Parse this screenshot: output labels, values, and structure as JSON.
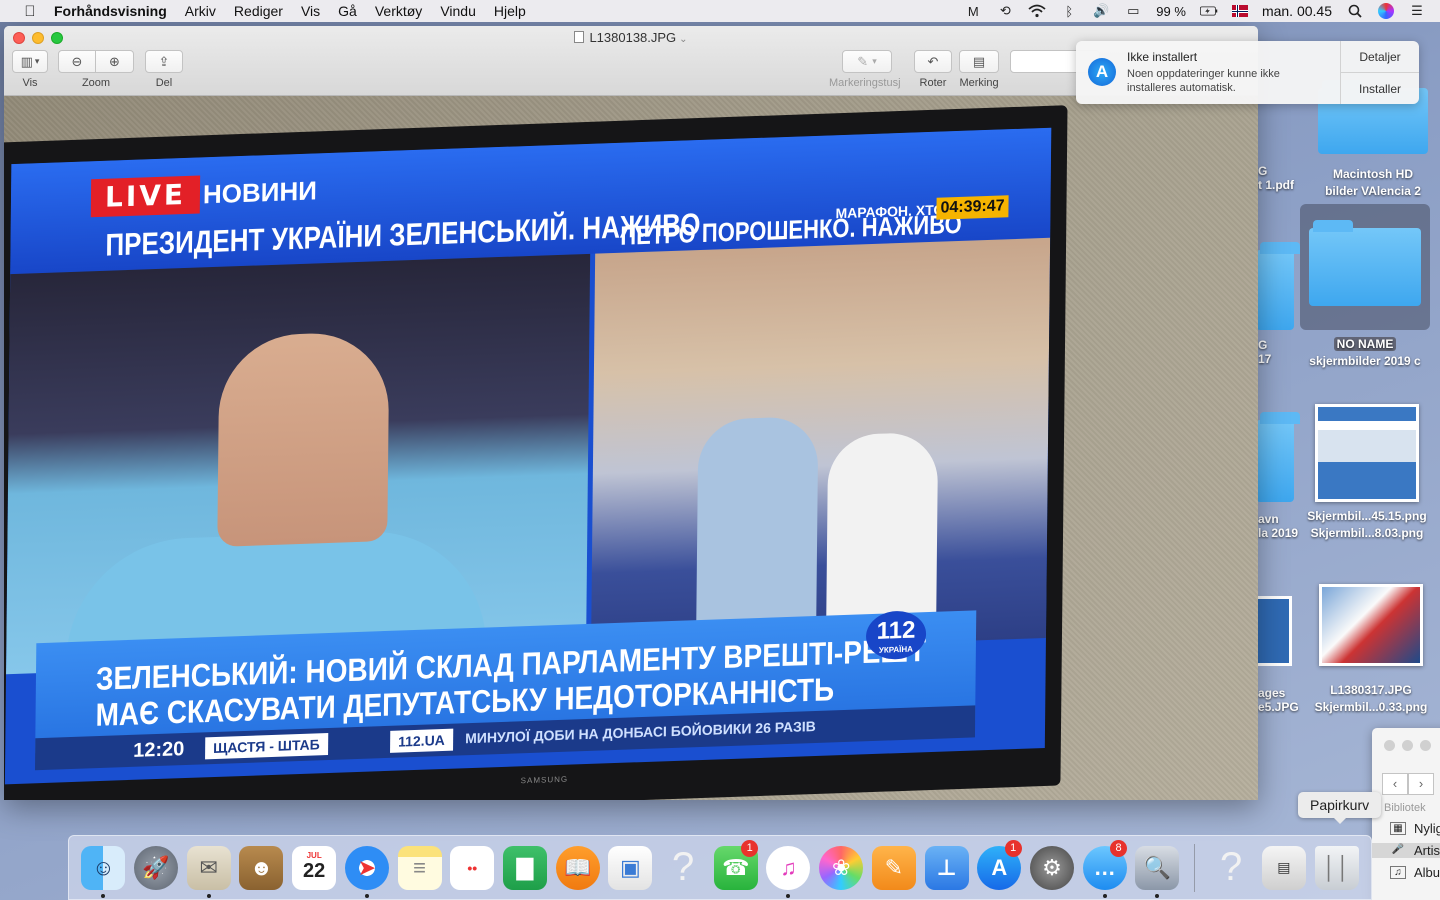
{
  "menubar": {
    "app_name": "Forhåndsvisning",
    "menus": [
      "Arkiv",
      "Rediger",
      "Vis",
      "Gå",
      "Verktøy",
      "Vindu",
      "Hjelp"
    ],
    "battery": "99 %",
    "clock": "man. 00.45"
  },
  "window": {
    "title": "L1380138.JPG",
    "toolbar": {
      "view_label": "Vis",
      "zoom_label": "Zoom",
      "share_label": "Del",
      "markup_pen_label": "Markeringstusj",
      "rotate_label": "Roter",
      "markup_label": "Merking"
    }
  },
  "photo": {
    "live": "LIVE",
    "novyny": "НОВИНИ",
    "headline_left": "ПРЕЗИДЕНТ УКРАЇНИ ЗЕЛЕНСЬКИЙ. НАЖИВО",
    "headline_right": "ПЕТРО ПОРОШЕНКО. НАЖИВО",
    "marathon": "МАРАФОН. ХТО?",
    "tv_clock": "04:39:47",
    "ticker_line1": "ЗЕЛЕНСЬКИЙ: НОВИЙ СКЛАД ПАРЛАМЕНТУ ВРЕШТІ-РЕШТ",
    "ticker_line2": "МАЄ СКАСУВАТИ ДЕПУТАТСЬКУ НЕДОТОРКАННІСТЬ",
    "channel_number": "112",
    "channel_country": "УКРАЇНА",
    "tv_time": "12:20",
    "strip_show": "ЩАСТЯ - ШТАБ",
    "strip_channel": "112.UA",
    "strip_news": "МИНУЛОЇ ДОБИ НА ДОНБАСІ БОЙОВИКИ 26 РАЗІВ",
    "tv_brand": "SAMSUNG"
  },
  "notification": {
    "title": "Ikke installert",
    "body": "Noen oppdateringer kunne ikke installeres automatisk.",
    "details_button": "Detaljer",
    "install_button": "Installer"
  },
  "desktop_icons": [
    {
      "name_line1": "Macintosh HD",
      "name_line2": "bilder VAlencia 2"
    },
    {
      "name_line1": "NO NAME",
      "name_line2": "skjermbilder 2019 c"
    },
    {
      "name_line1": "Skjermbil...45.15.png",
      "name_line2": "Skjermbil...8.03.png"
    },
    {
      "name_line1": "L1380317.JPG",
      "name_line2": "Skjermbil...0.33.png"
    }
  ],
  "desktop_partial_labels": {
    "a1": "G",
    "a2": "t 1.pdf",
    "b1": "G",
    "b2": "17",
    "c1": "avn",
    "c2": "la 2019",
    "d1": "ages",
    "d2": "e5.JPG"
  },
  "finder_sidebar": {
    "section": "Bibliotek",
    "items": [
      "Nylig",
      "Artis",
      "Albu"
    ]
  },
  "tooltip": "Papirkurv",
  "dock": {
    "calendar_month": "JUL",
    "calendar_day": "22",
    "facetime_badge": "1",
    "appstore_badge": "1",
    "messages_badge": "8",
    "question_mark": "?"
  }
}
